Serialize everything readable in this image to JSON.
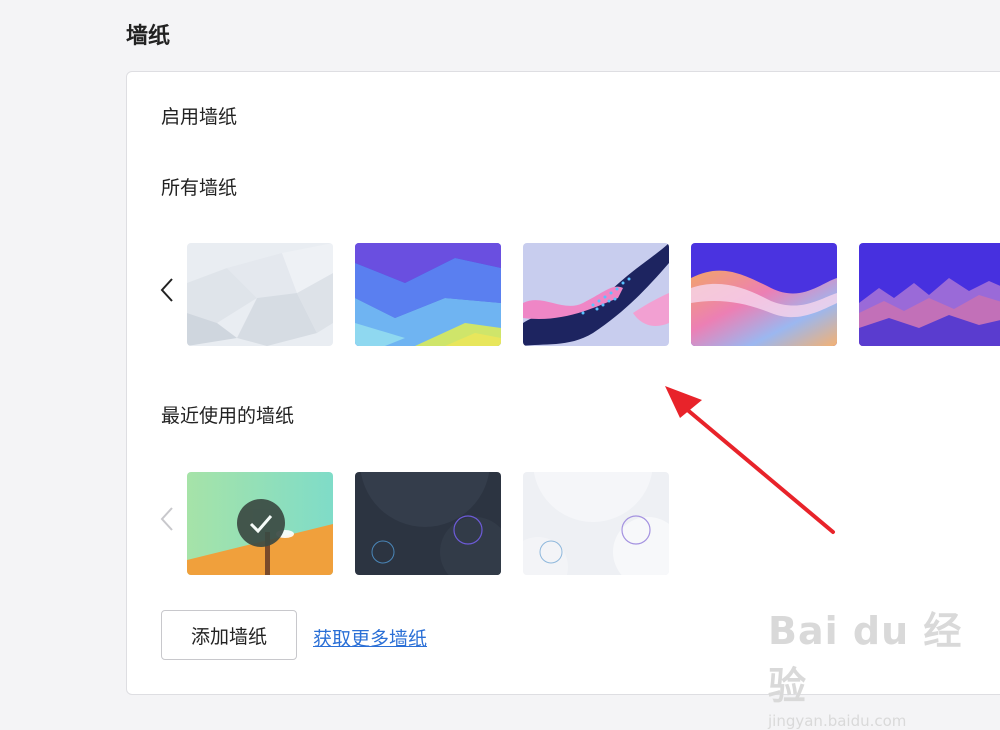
{
  "page": {
    "section_title": "墙纸"
  },
  "card": {
    "enable_label": "启用墙纸",
    "all_label": "所有墙纸",
    "recent_label": "最近使用的墙纸",
    "all_wallpapers": [
      {
        "name": "light-gray-polygon"
      },
      {
        "name": "blue-teal-layered"
      },
      {
        "name": "pink-dark-wave-dots"
      },
      {
        "name": "pastel-iridescent-wave"
      },
      {
        "name": "purple-mountains"
      }
    ],
    "recent_wallpapers": [
      {
        "name": "green-orange-lighthouse",
        "selected": true
      },
      {
        "name": "dark-slate-circles",
        "selected": false
      },
      {
        "name": "light-gray-circles",
        "selected": false
      }
    ],
    "add_button_label": "添加墙纸",
    "more_link_label": "获取更多墙纸"
  },
  "watermark": {
    "logo_text": "Bai du 经验",
    "url_text": "jingyan.baidu.com"
  },
  "colors": {
    "link": "#2a6fd6",
    "annotation_arrow": "#e8232a"
  }
}
